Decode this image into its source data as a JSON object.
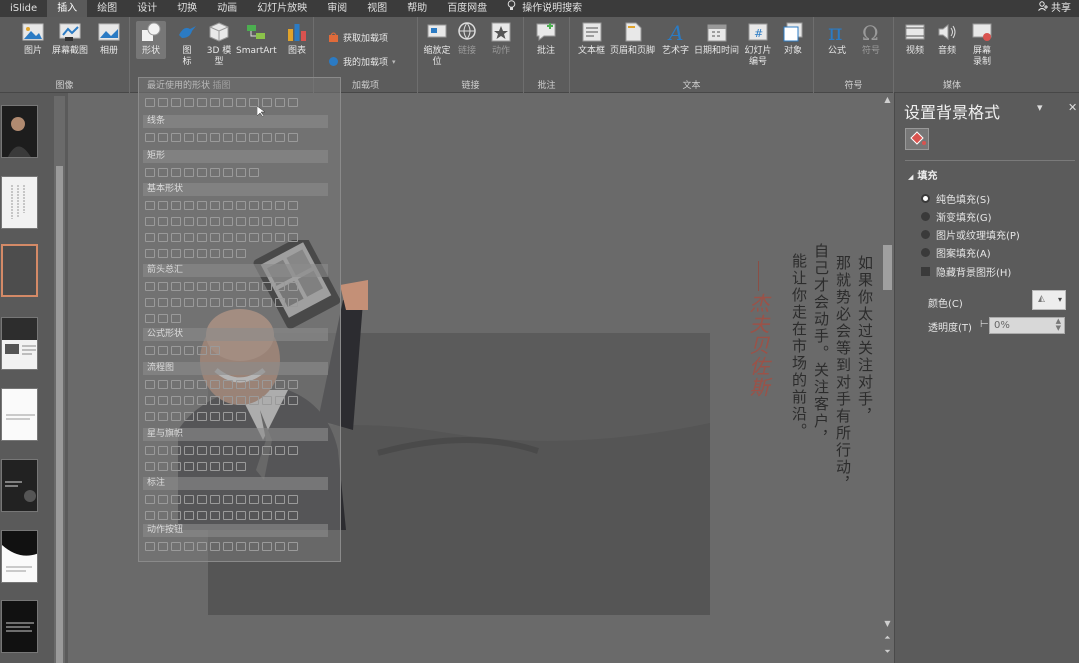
{
  "tabs": [
    {
      "label": "iSlide",
      "active": false
    },
    {
      "label": "插入",
      "active": true
    },
    {
      "label": "绘图",
      "active": false
    },
    {
      "label": "设计",
      "active": false
    },
    {
      "label": "切换",
      "active": false
    },
    {
      "label": "动画",
      "active": false
    },
    {
      "label": "幻灯片放映",
      "active": false
    },
    {
      "label": "审阅",
      "active": false
    },
    {
      "label": "视图",
      "active": false
    },
    {
      "label": "帮助",
      "active": false
    },
    {
      "label": "百度网盘",
      "active": false
    }
  ],
  "tell_me": "操作说明搜索",
  "share": "共享",
  "ribbon": {
    "images": {
      "label": "图像",
      "picture": "图片",
      "screenshot": "屏幕截图",
      "album": "相册"
    },
    "illustrations": {
      "label": "插图",
      "shapes": "形状",
      "icons": "图标",
      "model3d": "3D 模型",
      "smartart": "SmartArt",
      "chart": "图表"
    },
    "addins": {
      "label": "加载项",
      "get": "获取加载项",
      "mine": "我的加载项"
    },
    "links": {
      "label": "链接",
      "zoom": "缩放定位",
      "link": "链接",
      "action": "动作"
    },
    "comments": {
      "label": "批注",
      "comment": "批注"
    },
    "text": {
      "label": "文本",
      "textbox": "文本框",
      "header": "页眉和页脚",
      "wordart": "艺术字",
      "datetime": "日期和时间",
      "slidenum": "幻灯片 编号",
      "object": "对象"
    },
    "symbols": {
      "label": "符号",
      "equation": "公式",
      "symbol": "符号"
    },
    "media": {
      "label": "媒体",
      "video": "视频",
      "audio": "音频",
      "record": "屏幕 录制"
    }
  },
  "shapes_menu": {
    "recent": "最近使用的形状",
    "sections": [
      "线条",
      "矩形",
      "基本形状",
      "箭头总汇",
      "公式形状",
      "流程图",
      "星与旗帜",
      "标注",
      "动作按钮"
    ]
  },
  "slide": {
    "quote_col1": "如果你太过关注对手，",
    "quote_col2": "那就势必会等到对手有所行动，",
    "quote_col3": "自己才会动手。关注客户，",
    "quote_col4": "能让你走在市场的前沿。",
    "signature": "杰夫贝佐斯"
  },
  "pane": {
    "title": "设置背景格式",
    "fill_header": "填充",
    "options": [
      {
        "label": "纯色填充(S)",
        "on": true
      },
      {
        "label": "渐变填充(G)",
        "on": false
      },
      {
        "label": "图片或纹理填充(P)",
        "on": false
      },
      {
        "label": "图案填充(A)",
        "on": false
      }
    ],
    "hide_bg": "隐藏背景图形(H)",
    "color_label": "颜色(C)",
    "transparency_label": "透明度(T)",
    "transparency_value": "0%"
  }
}
